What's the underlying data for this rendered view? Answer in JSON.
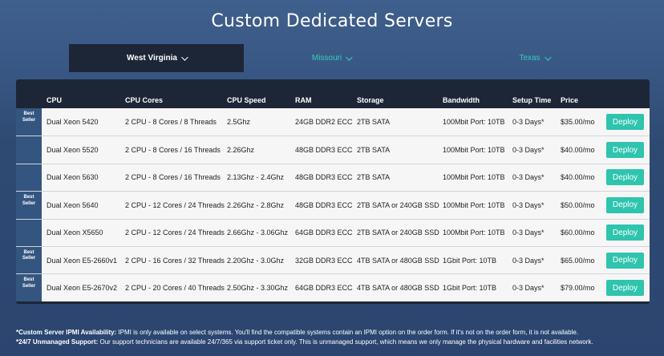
{
  "title": "Custom Dedicated Servers",
  "tabs": [
    {
      "label": "West Virginia",
      "active": true
    },
    {
      "label": "Missouri",
      "active": false
    },
    {
      "label": "Texas",
      "active": false
    }
  ],
  "table": {
    "headers": {
      "cpu": "CPU",
      "cores": "CPU Cores",
      "speed": "CPU Speed",
      "ram": "RAM",
      "storage": "Storage",
      "bandwidth": "Bandwidth",
      "setup": "Setup Time",
      "price": "Price"
    },
    "rows": [
      {
        "badge": "Best Seller",
        "cpu": "Dual Xeon 5420",
        "cores": "2 CPU - 8 Cores / 8 Threads",
        "speed": "2.5Ghz",
        "ram": "24GB DDR2 ECC",
        "storage": "2TB SATA",
        "bandwidth": "100Mbit Port: 10TB",
        "setup": "0-3 Days*",
        "price": "$35.00/mo",
        "action": "Deploy"
      },
      {
        "badge": "",
        "cpu": "Dual Xeon 5520",
        "cores": "2 CPU - 8 Cores / 16 Threads",
        "speed": "2.26Ghz",
        "ram": "48GB DDR3 ECC",
        "storage": "2TB SATA",
        "bandwidth": "100Mbit Port: 10TB",
        "setup": "0-3 Days*",
        "price": "$40.00/mo",
        "action": "Deploy"
      },
      {
        "badge": "",
        "cpu": "Dual Xeon 5630",
        "cores": "2 CPU - 8 Cores / 16 Threads",
        "speed": "2.13Ghz - 2.4Ghz",
        "ram": "48GB DDR3 ECC",
        "storage": "2TB SATA",
        "bandwidth": "100Mbit Port: 10TB",
        "setup": "0-3 Days*",
        "price": "$40.00/mo",
        "action": "Deploy"
      },
      {
        "badge": "Best Seller",
        "cpu": "Dual Xeon 5640",
        "cores": "2 CPU - 12 Cores / 24 Threads",
        "speed": "2.26Ghz - 2.8Ghz",
        "ram": "48GB DDR3 ECC",
        "storage": "2TB SATA or 240GB SSD",
        "bandwidth": "100Mbit Port: 10TB",
        "setup": "0-3 Days*",
        "price": "$50.00/mo",
        "action": "Deploy"
      },
      {
        "badge": "",
        "cpu": "Dual Xeon X5650",
        "cores": "2 CPU - 12 Cores / 24 Threads",
        "speed": "2.66Ghz - 3.06Ghz",
        "ram": "64GB DDR3 ECC",
        "storage": "2TB SATA or 240GB SSD",
        "bandwidth": "100Mbit Port: 10TB",
        "setup": "0-3 Days*",
        "price": "$60.00/mo",
        "action": "Deploy"
      },
      {
        "badge": "Best Seller",
        "cpu": "Dual Xeon E5-2660v1",
        "cores": "2 CPU - 16 Cores / 32 Threads",
        "speed": "2.20Ghz - 3.0Ghz",
        "ram": "32GB DDR3 ECC",
        "storage": "4TB SATA or 480GB SSD",
        "bandwidth": "1Gbit Port: 10TB",
        "setup": "0-3 Days*",
        "price": "$65.00/mo",
        "action": "Deploy"
      },
      {
        "badge": "Best Seller",
        "cpu": "Dual Xeon E5-2670v2",
        "cores": "2 CPU - 20 Cores / 40 Threads",
        "speed": "2.50Ghz - 3.30Ghz",
        "ram": "64GB DDR3 ECC",
        "storage": "4TB SATA or 480GB SSD",
        "bandwidth": "1Gbit Port: 10TB",
        "setup": "0-3 Days*",
        "price": "$79.00/mo",
        "action": "Deploy"
      }
    ]
  },
  "notes": [
    {
      "label": "*Custom Server IPMI Availability:",
      "text": " IPMI is only available on select systems. You'll find the compatible systems contain an IPMI option on the order form. If it's not on the order form, it is not available."
    },
    {
      "label": "*24/7 Unmanaged Support:",
      "text": " Our support technicians are available 24/7/365 via support ticket only. This is unmanaged support, which means we only manage the physical hardware and facilities network."
    }
  ],
  "colors": {
    "accent": "#2ec4ad",
    "header_bg": "#1c2636",
    "badge_bg": "#34557f"
  }
}
